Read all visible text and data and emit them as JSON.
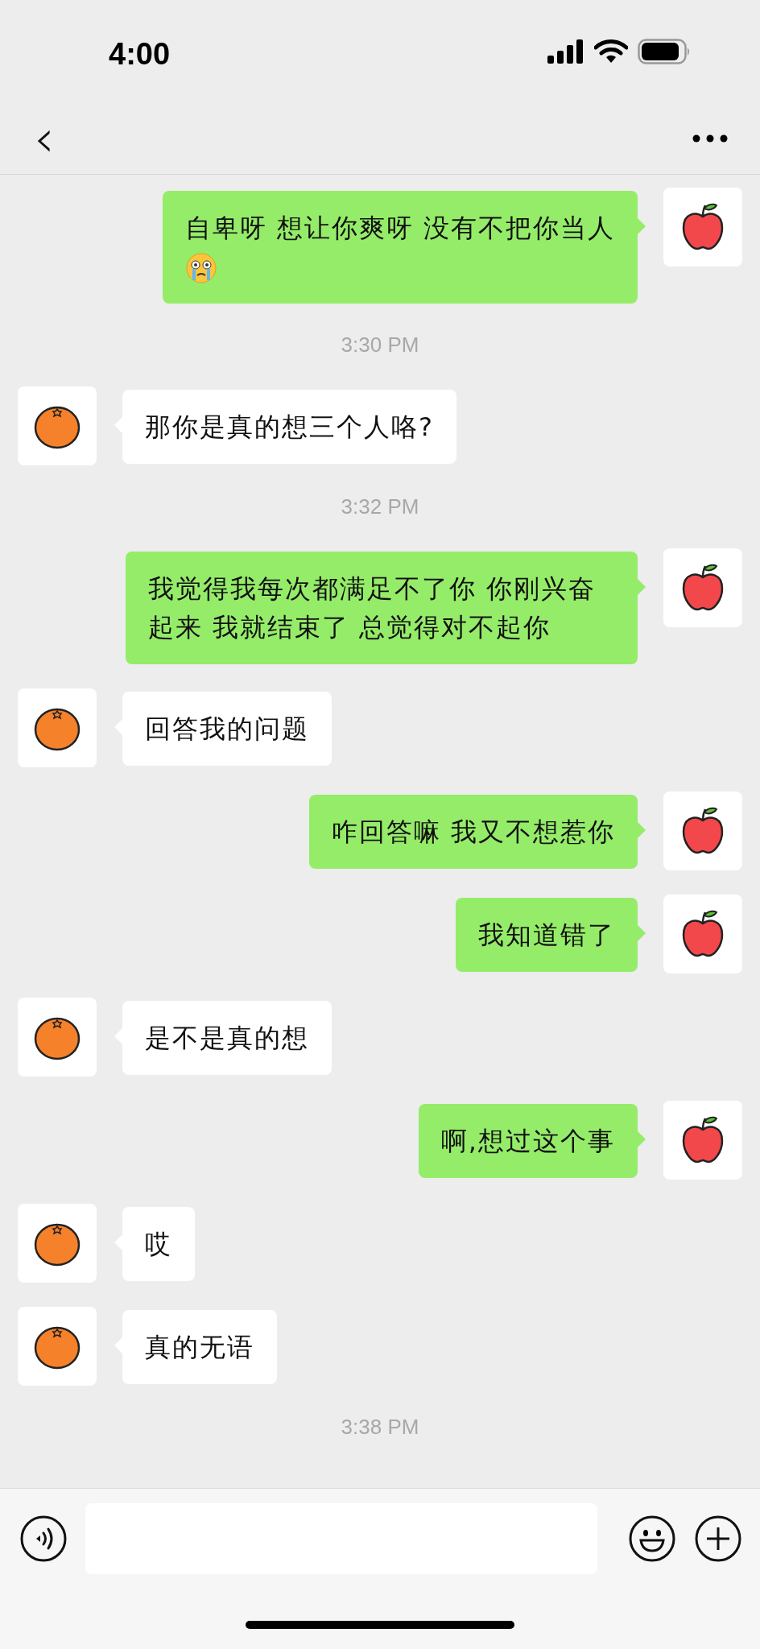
{
  "status_bar": {
    "time": "4:00"
  },
  "nav": {
    "back": "‹"
  },
  "items": [
    {
      "kind": "sent",
      "text": "自卑呀 想让你爽呀 没有不把你当人",
      "crying_emoji": true
    },
    {
      "kind": "time",
      "text": "3:30 PM"
    },
    {
      "kind": "received",
      "text": "那你是真的想三个人咯?"
    },
    {
      "kind": "time",
      "text": "3:32 PM"
    },
    {
      "kind": "sent",
      "text": "我觉得我每次都满足不了你 你刚兴奋起来 我就结束了 总觉得对不起你"
    },
    {
      "kind": "received",
      "text": "回答我的问题"
    },
    {
      "kind": "sent",
      "text": "咋回答嘛 我又不想惹你"
    },
    {
      "kind": "sent",
      "text": "我知道错了"
    },
    {
      "kind": "received",
      "text": "是不是真的想"
    },
    {
      "kind": "sent",
      "text": "啊,想过这个事"
    },
    {
      "kind": "received",
      "text": "哎"
    },
    {
      "kind": "received",
      "text": "真的无语"
    },
    {
      "kind": "time",
      "text": "3:38 PM"
    }
  ]
}
